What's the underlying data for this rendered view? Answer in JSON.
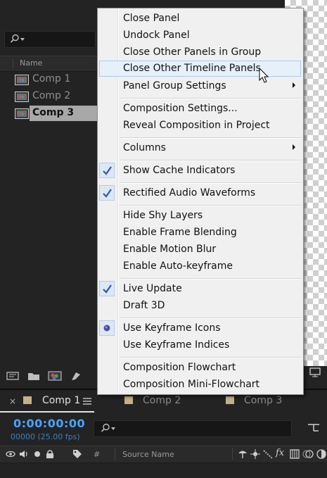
{
  "project": {
    "column_name": "Name",
    "items": [
      {
        "label": "Comp 1",
        "selected": false
      },
      {
        "label": "Comp 2",
        "selected": false
      },
      {
        "label": "Comp 3",
        "selected": true
      }
    ]
  },
  "timeline": {
    "tabs": [
      {
        "label": "Comp 1",
        "active": true
      },
      {
        "label": "Comp 2",
        "active": false
      },
      {
        "label": "Comp 3",
        "active": false
      }
    ],
    "close_glyph": "×",
    "timecode": "0:00:00:00",
    "fps": "00000 (25.00 fps)",
    "layer_columns": {
      "number": "#",
      "source_name": "Source Name"
    }
  },
  "context_menu": {
    "items": [
      {
        "label": "Close Panel"
      },
      {
        "label": "Undock Panel"
      },
      {
        "label": "Close Other Panels in Group"
      },
      {
        "label": "Close Other Timeline Panels",
        "hovered": true
      },
      {
        "label": "Panel Group Settings",
        "submenu": true
      },
      {
        "label": "Composition Settings..."
      },
      {
        "label": "Reveal Composition in Project"
      },
      {
        "label": "Columns",
        "submenu": true
      },
      {
        "label": "Show Cache Indicators",
        "checked": true
      },
      {
        "label": "Rectified Audio Waveforms",
        "checked": true
      },
      {
        "label": "Hide Shy Layers"
      },
      {
        "label": "Enable Frame Blending"
      },
      {
        "label": "Enable Motion Blur"
      },
      {
        "label": "Enable Auto-keyframe"
      },
      {
        "label": "Live Update",
        "checked": true
      },
      {
        "label": "Draft 3D"
      },
      {
        "label": "Use Keyframe Icons",
        "radio": true
      },
      {
        "label": "Use Keyframe Indices"
      },
      {
        "label": "Composition Flowchart"
      },
      {
        "label": "Composition Mini-Flowchart"
      }
    ]
  },
  "colors": {
    "accent_blue": "#4aa3ff",
    "check_blue": "#2b55c8",
    "comp_swatch": "#c5b08a"
  }
}
